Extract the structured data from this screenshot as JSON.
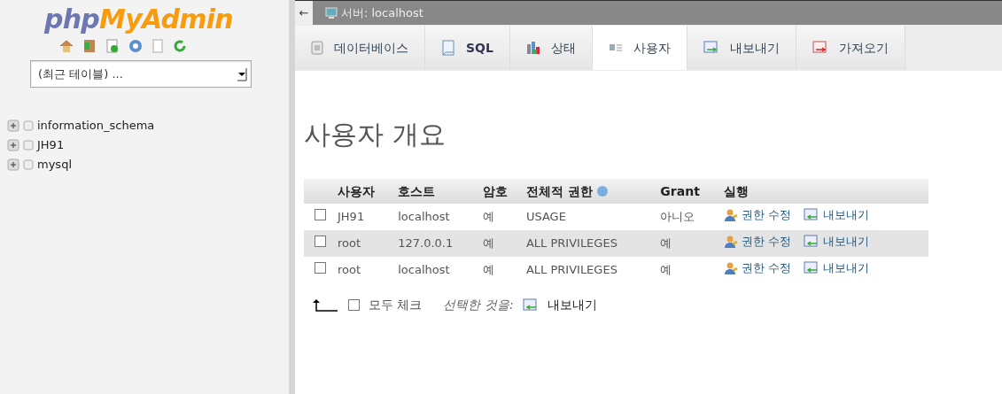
{
  "sidebar": {
    "logo": {
      "php": "php",
      "rest": "MyAdmin"
    },
    "recent_tables": {
      "value": "(최근 테이블) ..."
    },
    "databases": [
      {
        "name": "information_schema"
      },
      {
        "name": "JH91"
      },
      {
        "name": "mysql"
      }
    ]
  },
  "breadcrumb": {
    "back": "←",
    "server": "서버: localhost"
  },
  "tabs": [
    {
      "label": "데이터베이스",
      "kind": "database",
      "selected": false
    },
    {
      "label": "SQL",
      "kind": "sql",
      "selected": false
    },
    {
      "label": "상태",
      "kind": "chart",
      "selected": false
    },
    {
      "label": "사용자",
      "kind": "users",
      "selected": true
    },
    {
      "label": "내보내기",
      "kind": "export",
      "selected": false
    },
    {
      "label": "가져오기",
      "kind": "import",
      "selected": false
    }
  ],
  "heading": "사용자 개요",
  "table": {
    "columns": [
      "사용자",
      "호스트",
      "암호",
      "전체적 권한",
      "Grant",
      "실행"
    ],
    "rows": [
      {
        "checked": false,
        "user": "JH91",
        "host": "localhost",
        "password": "예",
        "privileges": "USAGE",
        "grant": "아니오",
        "edit": "권한 수정",
        "export": "내보내기"
      },
      {
        "checked": false,
        "user": "root",
        "host": "127.0.0.1",
        "password": "예",
        "privileges": "ALL PRIVILEGES",
        "grant": "예",
        "edit": "권한 수정",
        "export": "내보내기"
      },
      {
        "checked": false,
        "user": "root",
        "host": "localhost",
        "password": "예",
        "privileges": "ALL PRIVILEGES",
        "grant": "예",
        "edit": "권한 수정",
        "export": "내보내기"
      }
    ]
  },
  "footer": {
    "check_all": {
      "label": "모두 체크",
      "checked": false
    },
    "with_selected": "선택한 것을:",
    "export": "내보내기"
  }
}
